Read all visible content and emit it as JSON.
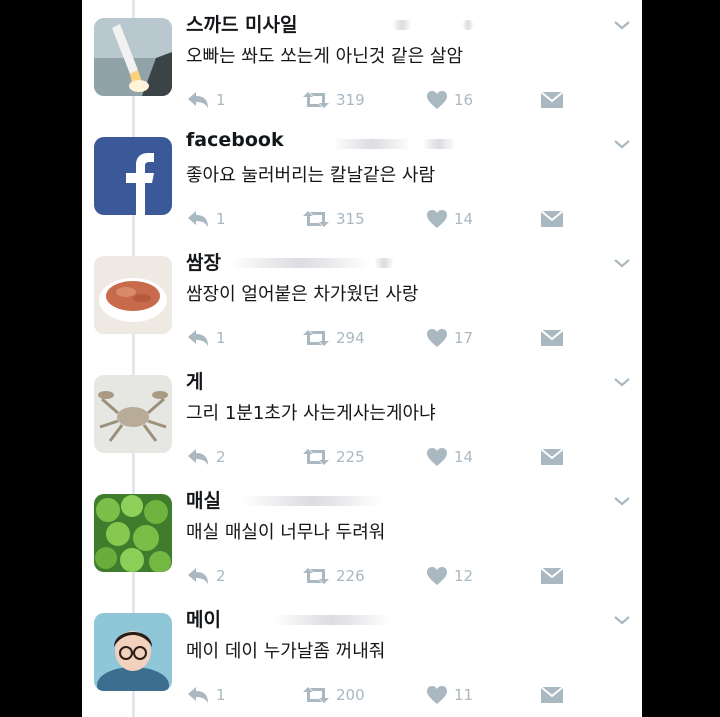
{
  "tweets": [
    {
      "name": "스까드 미사일",
      "text": "오빠는 쏴도 쏘는게 아닌것 같은 살암",
      "replies": "1",
      "retweets": "319",
      "likes": "16",
      "avatar_icon": "missile-avatar"
    },
    {
      "name": "facebook",
      "text": "좋아요 눌러버리는 칼날같은 사람",
      "replies": "1",
      "retweets": "315",
      "likes": "14",
      "avatar_icon": "facebook-avatar"
    },
    {
      "name": "쌈장",
      "text": "쌈장이 얼어붙은 차가웠던 사랑",
      "replies": "1",
      "retweets": "294",
      "likes": "17",
      "avatar_icon": "ssamjang-avatar"
    },
    {
      "name": "게",
      "text": "그리 1분1초가 사는게사는게아냐",
      "replies": "2",
      "retweets": "225",
      "likes": "14",
      "avatar_icon": "crab-avatar"
    },
    {
      "name": "매실",
      "text": "매실 매실이 너무나 두려워",
      "replies": "2",
      "retweets": "226",
      "likes": "12",
      "avatar_icon": "plum-avatar"
    },
    {
      "name": "메이",
      "text": "메이 데이 누가날좀 꺼내줘",
      "replies": "1",
      "retweets": "200",
      "likes": "11",
      "avatar_icon": "mei-avatar"
    }
  ],
  "colors": {
    "icon_gray": "#aab8c2",
    "text": "#14171a",
    "facebook_blue": "#3b5998",
    "thread_line": "#e1e8ed"
  }
}
